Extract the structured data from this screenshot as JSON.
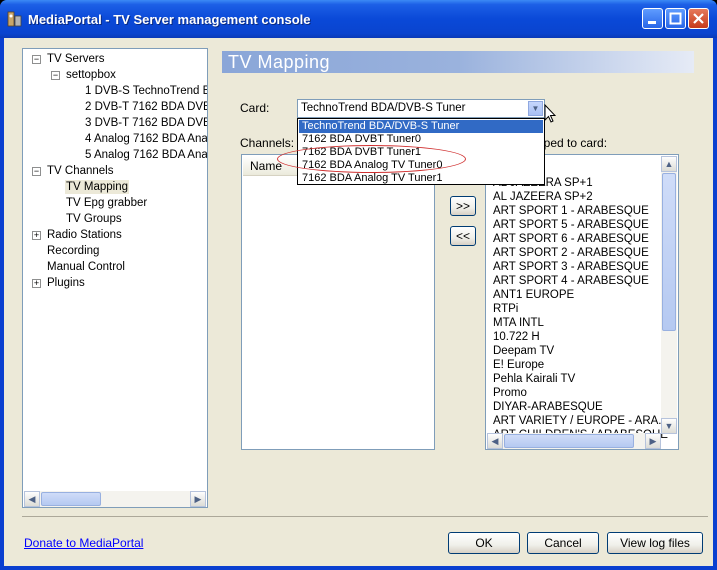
{
  "window": {
    "title": "MediaPortal - TV Server management console"
  },
  "tree": {
    "items": [
      {
        "label": "TV Servers",
        "expander": "−"
      },
      {
        "label": "settopbox",
        "expander": "−"
      },
      {
        "label": "1 DVB-S TechnoTrend B"
      },
      {
        "label": "2 DVB-T 7162 BDA DVB"
      },
      {
        "label": "3 DVB-T 7162 BDA DVB"
      },
      {
        "label": "4 Analog 7162 BDA Anal"
      },
      {
        "label": "5 Analog 7162 BDA Anal"
      },
      {
        "label": "TV Channels",
        "expander": "−"
      },
      {
        "label": "TV Mapping"
      },
      {
        "label": "TV Epg grabber"
      },
      {
        "label": "TV Groups"
      },
      {
        "label": "Radio Stations",
        "expander": "+"
      },
      {
        "label": "Recording"
      },
      {
        "label": "Manual Control"
      },
      {
        "label": "Plugins",
        "expander": "+"
      }
    ]
  },
  "header": {
    "title": "TV Mapping"
  },
  "card": {
    "label": "Card:",
    "selected": "TechnoTrend BDA/DVB-S Tuner",
    "options": [
      "TechnoTrend BDA/DVB-S Tuner",
      "7162 BDA DVBT Tuner0",
      "7162 BDA DVBT Tuner1",
      "7162 BDA Analog TV Tuner0",
      "7162 BDA Analog TV Tuner1"
    ]
  },
  "channels_label": "Channels:",
  "mapped_label": "pped to card:",
  "left_list": {
    "column": "Name"
  },
  "buttons": {
    "add": ">>",
    "remove": "<<",
    "ok": "OK",
    "cancel": "Cancel",
    "view_log": "View log files"
  },
  "mapped_channels": [
    "AL JAZEERA SP+1",
    "AL JAZEERA SP+2",
    "ART SPORT 1 - ARABESQUE",
    "ART SPORT 5 - ARABESQUE",
    "ART SPORT 6 - ARABESQUE",
    "ART SPORT 2 - ARABESQUE",
    "ART SPORT 3 - ARABESQUE",
    "ART SPORT 4 - ARABESQUE",
    "ANT1 EUROPE",
    "RTPi",
    "MTA INTL",
    "10.722 H",
    "Deepam TV",
    "E! Europe",
    "Pehla Kairali TV",
    "Promo",
    "DIYAR-ARABESQUE",
    "ART VARIETY / EUROPE - ARA...",
    "ART CHILDREN'S / ARABESQUE"
  ],
  "footer": {
    "donate_link": "Donate to MediaPortal"
  }
}
